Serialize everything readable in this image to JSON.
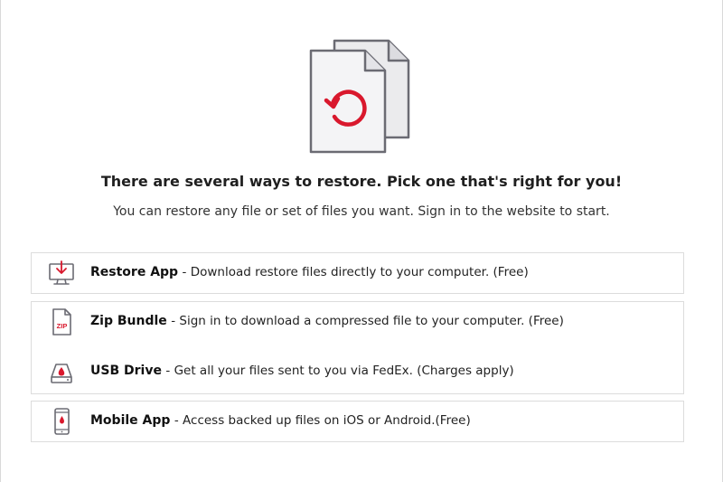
{
  "header": {
    "title": "There are several ways to restore. Pick one that's right for you!",
    "subtitle": "You can restore any file or set of files you want. Sign in to the website to start."
  },
  "options": [
    {
      "name": "Restore App",
      "description": "- Download restore files directly to your computer. (Free)",
      "icon": "monitor-download-icon"
    },
    {
      "name": "Zip Bundle",
      "description": "- Sign in to download a compressed file to your computer. (Free)",
      "icon": "zip-file-icon",
      "icon_text": "ZIP"
    },
    {
      "name": "USB Drive",
      "description": "- Get all your files sent to you via FedEx. (Charges apply)",
      "icon": "usb-drive-icon"
    },
    {
      "name": "Mobile App",
      "description": "- Access backed up files on iOS or Android.(Free)",
      "icon": "mobile-phone-icon"
    }
  ],
  "colors": {
    "accent": "#d9182d",
    "icon_stroke": "#6b6b73",
    "border": "#dcdcdc"
  },
  "hero_icon": "restore-documents-icon"
}
